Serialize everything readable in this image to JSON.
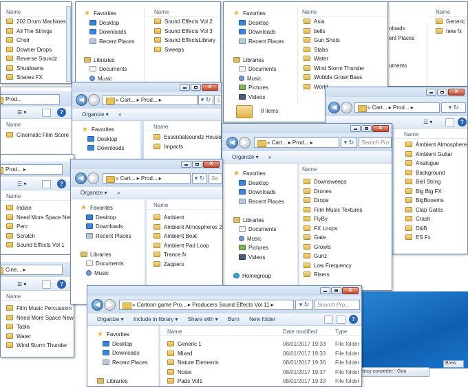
{
  "common": {
    "name_col": "Name",
    "favorites": "Favorites",
    "desktop": "Desktop",
    "downloads": "Downloads",
    "recent": "Recent Places",
    "libraries": "Libraries",
    "documents": "Documents",
    "music": "Music",
    "pictures": "Pictures",
    "videos": "Videos",
    "homegroup": "Homegroup",
    "organize": "Organize ▾",
    "more": "»",
    "nav_arrows": "▾ ↻",
    "cart": "« Cart... ▸ Prod... ▸",
    "prod": "Prod... ▸",
    "help": "?"
  },
  "w1": {
    "items": [
      "202 Drum Machines",
      "All The Strings",
      "Choir",
      "Downer Drops",
      "Reverse Soundz",
      "Shutdowns",
      "Snares FX"
    ]
  },
  "w2": {
    "items": [
      "Sound Effects Vol 2",
      "Sound Effects Vol 3",
      "Sound EffectsLibrary",
      "Sweeps"
    ]
  },
  "w3": {
    "items": [
      "Asia",
      "bells",
      "Gun Shots",
      "Stabs",
      "Water",
      "Wind Storm Thunder",
      "Wobble Growl Bass",
      "World"
    ],
    "status": "8 items"
  },
  "w4": {
    "partial_nav": [
      "nloads",
      "ent Places",
      "uments"
    ],
    "items": [
      "Generic 3",
      "new fx"
    ]
  },
  "w5": {
    "items": [
      "Cinematic Film Score"
    ],
    "crumb": "Prod..."
  },
  "w6": {
    "items": [
      "Essentialsoundz House",
      "Impacts"
    ]
  },
  "w7": {
    "items": [
      "Ambient Atmospheres",
      "Ambient Guitar",
      "Analogue",
      "Background",
      "Bell String",
      "Big Big FX",
      "BigBooems",
      "Clap Gates",
      "Crash",
      "D&B",
      "ES Fx"
    ]
  },
  "w8": {
    "items": [
      "Downsweeps",
      "Drones",
      "Drops",
      "Film Music Textures",
      "FlyBy",
      "FX Loops",
      "Gate",
      "Growls",
      "Gunz",
      "Low Frequency",
      "Risers"
    ],
    "search": "Search Pro..."
  },
  "w9": {
    "items": [
      "Indian",
      "Need More Space New",
      "Perc",
      "Scratch",
      "Sound Effects Vol 1"
    ]
  },
  "w10": {
    "items": [
      "Ambient",
      "Ambient Atmospheres 2",
      "Ambient Beat",
      "Ambient Pad Loop",
      "Trance fx",
      "Zappers"
    ],
    "search": "Se"
  },
  "w11": {
    "crumb": "Cine... ▸",
    "items": [
      "Film Music Percussion",
      "Need More Space New",
      "Tabla",
      "Water",
      "Wind Storm Thunder"
    ]
  },
  "w12": {
    "address": "« Cartoon game Pro... ▸ Producers Sound Effects Vol 11 ▸",
    "search": "Search Pro...",
    "commands": [
      "Organize ▾",
      "Include in library ▾",
      "Share with ▾",
      "Burn",
      "New folder"
    ],
    "columns": [
      "Name",
      "Date modified",
      "Type"
    ],
    "rows": [
      {
        "name": "Generic 1",
        "date": "08/01/2017 19:33",
        "type": "File folder"
      },
      {
        "name": "Mixed",
        "date": "08/01/2017 19:33",
        "type": "File folder"
      },
      {
        "name": "Nature Elements",
        "date": "08/01/2017 19:36",
        "type": "File folder"
      },
      {
        "name": "Noise",
        "date": "08/01/2017 19:37",
        "type": "File folder"
      },
      {
        "name": "Pads Vol1",
        "date": "08/01/2017 19:33",
        "type": "File folder"
      }
    ]
  },
  "taskbar": {
    "currency": "ency converter - Goo",
    "small": "Brew"
  }
}
